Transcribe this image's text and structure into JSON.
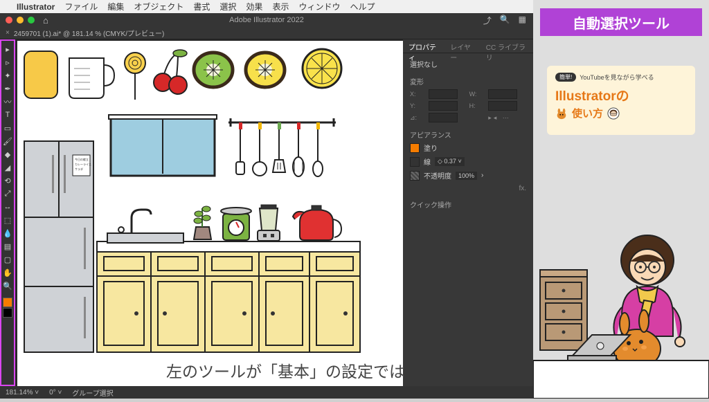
{
  "menubar": {
    "app": "Illustrator",
    "items": [
      "ファイル",
      "編集",
      "オブジェクト",
      "書式",
      "選択",
      "効果",
      "表示",
      "ウィンドウ",
      "ヘルプ"
    ]
  },
  "titlebar": {
    "title": "Adobe Illustrator 2022"
  },
  "doc_tab": {
    "label": "2459701 (1).ai* @ 181.14 % (CMYK/プレビュー)"
  },
  "panel": {
    "tabs": [
      "プロパティ",
      "レイヤー",
      "CC ライブラリ"
    ],
    "noselect": "選択なし",
    "transform": "変形",
    "appearance": "アピアランス",
    "fill": "塗り",
    "stroke": "線",
    "stroke_val": "0.37",
    "opacity": "不透明度",
    "opacity_val": "100%",
    "quick": "クイック操作"
  },
  "status": {
    "zoom": "181.14%",
    "rot": "0°",
    "mode": "グループ選択"
  },
  "subtitle": "左のツールが「基本」の設定では",
  "headline": "自動選択ツール",
  "badge": {
    "pill": "簡単!",
    "top": "YouTubeを見ながら学べる",
    "main": "Illustratorの",
    "sub": "使い方"
  }
}
